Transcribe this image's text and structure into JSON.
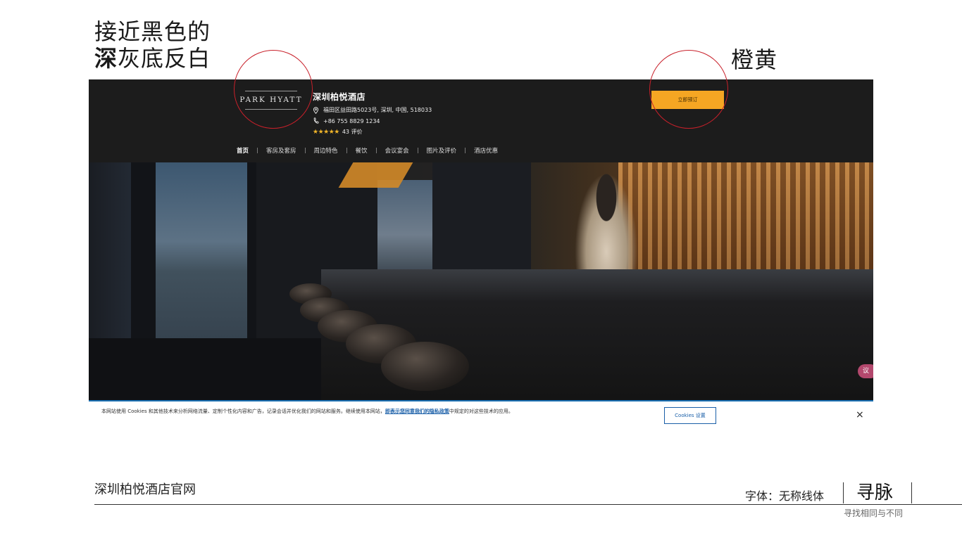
{
  "annotations": {
    "left_line1": "接近黑色的",
    "left_line2_bold": "深",
    "left_line2_rest": "灰底反白",
    "right": "橙黄"
  },
  "site": {
    "logo_text": "PARK HYATT",
    "hotel_name": "深圳柏悦酒店",
    "address": "福田区益田路5023号, 深圳, 中国, 518033",
    "phone": "+86 755 8829 1234",
    "rating_stars": "★★★★★",
    "rating_value": 4.5,
    "reviews": "43 评价",
    "book_button": "立即预订",
    "nav": [
      "首页",
      "客房及套房",
      "周边特色",
      "餐饮",
      "会议宴会",
      "图片及评价",
      "酒店优惠"
    ],
    "hero_badge": "议",
    "colors": {
      "header_bg": "#1c1c1c",
      "book_button": "#f5a623",
      "link": "#1a5fa8"
    }
  },
  "cookie": {
    "text_before": "本网站使用 Cookies 和其他技术来分析网络流量、定制个性化内容和广告，记录会话并优化我们的网站和服务。继续使用本网站，",
    "link_text": "即表示您同意我们的隐私政策",
    "text_after": "中规定的对这些技术的应用。",
    "settings_button": "Cookies 设置",
    "close": "×"
  },
  "footer": {
    "title": "深圳柏悦酒店官网",
    "font_note": "字体：无称线体",
    "brand": "寻脉",
    "tagline": "寻找相同与不同"
  }
}
